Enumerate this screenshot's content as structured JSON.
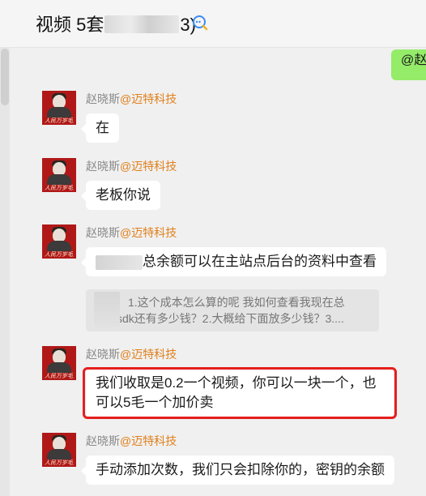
{
  "header": {
    "title_prefix": "视频  5套",
    "title_suffix": "3)",
    "chat_icon": "chat-bubble-icon"
  },
  "own_message": {
    "text": "@赵"
  },
  "messages": [
    {
      "sender": "赵晓斯",
      "company": "@迈特科技",
      "text": "在"
    },
    {
      "sender": "赵晓斯",
      "company": "@迈特科技",
      "text": "老板你说"
    },
    {
      "sender": "赵晓斯",
      "company": "@迈特科技",
      "text": "总余额可以在主站点后台的资料中查看",
      "quote_line1": "1.这个成本怎么算的呢  我如何查看我现在总",
      "quote_line2": "后台sdk还有多少钱？2.大概给下面放多少钱？3...."
    },
    {
      "sender": "赵晓斯",
      "company": "@迈特科技",
      "line1": "我们收取是0.2一个视频，你可以一块一个，也",
      "line2": "可以5毛一个加价卖"
    },
    {
      "sender": "赵晓斯",
      "company": "@迈特科技",
      "text": "手动添加次数，我们只会扣除你的，密钥的余额"
    }
  ]
}
